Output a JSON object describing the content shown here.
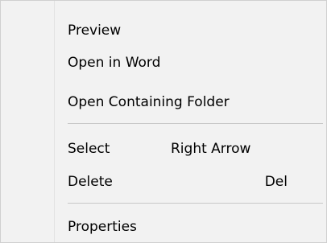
{
  "menu": {
    "items": [
      {
        "label": "Preview",
        "shortcut": ""
      },
      {
        "label": "Open in Word",
        "shortcut": ""
      },
      {
        "label": "Open Containing Folder",
        "shortcut": ""
      },
      {
        "label": "Select",
        "shortcut": "Right Arrow"
      },
      {
        "label": "Delete",
        "shortcut": "Del"
      },
      {
        "label": "Properties",
        "shortcut": ""
      }
    ]
  }
}
